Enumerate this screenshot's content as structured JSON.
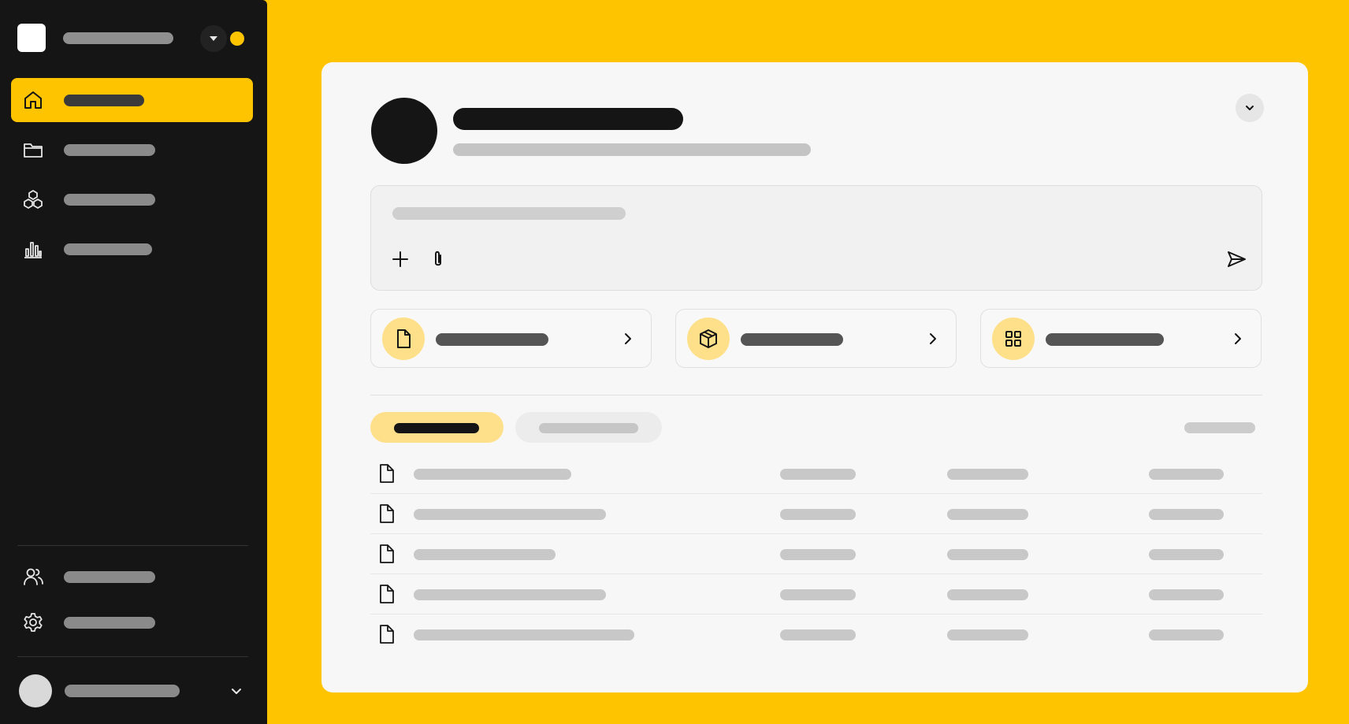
{
  "colors": {
    "accent": "#FFC400",
    "accent_soft": "#FFE08A",
    "sidebar_bg": "#151515",
    "card_bg": "#F7F7F7"
  },
  "sidebar": {
    "logo_icon": "logo-square",
    "workspace_caret_icon": "caret-down-icon",
    "status_dot_icon": "status-dot",
    "items": [
      {
        "icon": "home-icon",
        "active": true
      },
      {
        "icon": "folder-icon",
        "active": false
      },
      {
        "icon": "cubes-icon",
        "active": false
      },
      {
        "icon": "bar-chart-icon",
        "active": false
      }
    ],
    "bottom_items": [
      {
        "icon": "users-icon"
      },
      {
        "icon": "gear-icon"
      }
    ],
    "user_caret_icon": "chevron-down-icon"
  },
  "header": {
    "menu_icon": "chevron-down-icon"
  },
  "composer": {
    "add_icon": "plus-icon",
    "attach_icon": "paperclip-icon",
    "send_icon": "send-icon"
  },
  "quick_actions": [
    {
      "icon": "document-icon"
    },
    {
      "icon": "package-icon"
    },
    {
      "icon": "grid-icon"
    }
  ],
  "tabs": [
    {
      "active": true
    },
    {
      "active": false
    }
  ],
  "table": {
    "row_count": 5,
    "row_icon": "file-icon"
  }
}
